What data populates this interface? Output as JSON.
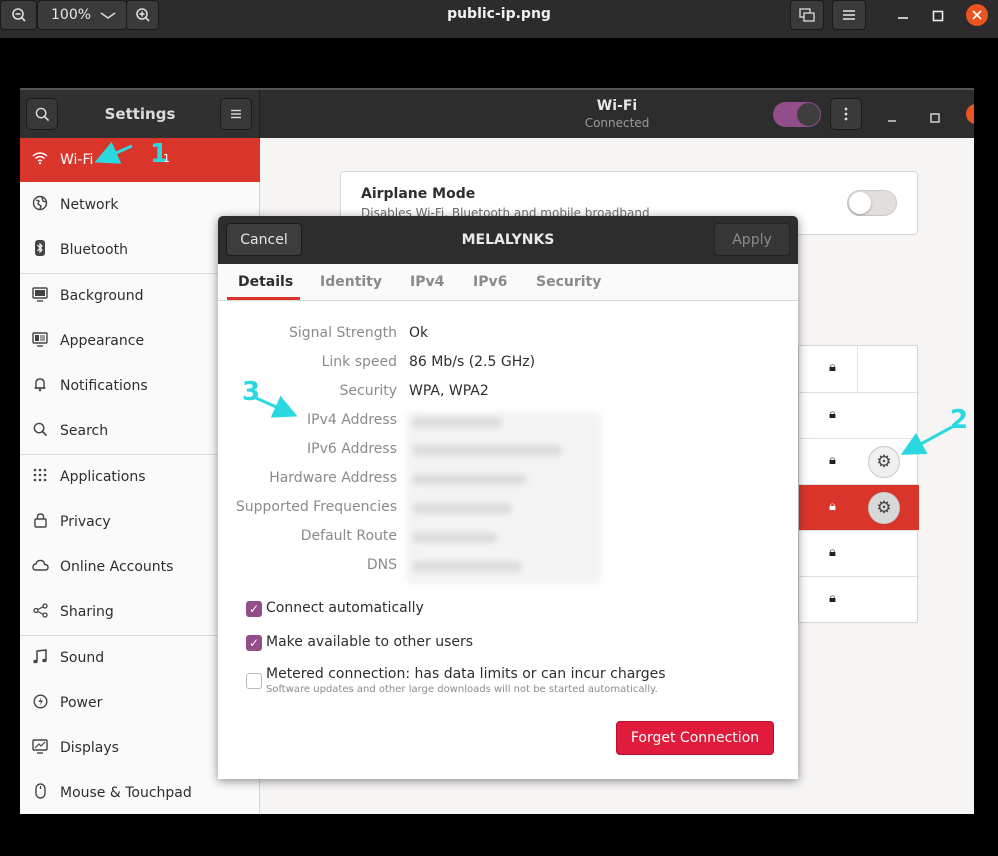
{
  "viewer": {
    "zoom": "100%",
    "title": "public-ip.png",
    "icons": [
      "zoom-out-icon",
      "chevron-down-icon",
      "zoom-in-icon",
      "fit-window-icon",
      "menu-icon",
      "minimize-icon",
      "maximize-icon",
      "close-icon"
    ]
  },
  "settings": {
    "title": "Settings",
    "header_title": "Wi-Fi",
    "header_subtitle": "Connected",
    "sidebar": [
      {
        "label": "Wi-Fi",
        "icon": "wifi-icon",
        "active": true
      },
      {
        "label": "Network",
        "icon": "globe-icon"
      },
      {
        "label": "Bluetooth",
        "icon": "bluetooth-icon"
      },
      {
        "label": "Background",
        "icon": "monitor-icon"
      },
      {
        "label": "Appearance",
        "icon": "appearance-icon"
      },
      {
        "label": "Notifications",
        "icon": "bell-icon"
      },
      {
        "label": "Search",
        "icon": "search-icon"
      },
      {
        "label": "Applications",
        "icon": "apps-grid-icon"
      },
      {
        "label": "Privacy",
        "icon": "lock-icon"
      },
      {
        "label": "Online Accounts",
        "icon": "cloud-icon"
      },
      {
        "label": "Sharing",
        "icon": "share-icon"
      },
      {
        "label": "Sound",
        "icon": "music-note-icon"
      },
      {
        "label": "Power",
        "icon": "power-icon"
      },
      {
        "label": "Displays",
        "icon": "display-icon"
      },
      {
        "label": "Mouse & Touchpad",
        "icon": "mouse-icon"
      }
    ],
    "airplane": {
      "title": "Airplane Mode",
      "subtitle": "Disables Wi-Fi, Bluetooth and mobile broadband"
    }
  },
  "dialog": {
    "cancel": "Cancel",
    "title": "MELALYNKS",
    "apply": "Apply",
    "tabs": [
      "Details",
      "Identity",
      "IPv4",
      "IPv6",
      "Security"
    ],
    "details": {
      "signal_strength_label": "Signal Strength",
      "signal_strength": "Ok",
      "link_speed_label": "Link speed",
      "link_speed": "86 Mb/s (2.5 GHz)",
      "security_label": "Security",
      "security": "WPA, WPA2",
      "ipv4_label": "IPv4 Address",
      "ipv6_label": "IPv6 Address",
      "hardware_label": "Hardware Address",
      "frequencies_label": "Supported Frequencies",
      "route_label": "Default Route",
      "dns_label": "DNS"
    },
    "connect_auto": "Connect automatically",
    "available_others": "Make available to other users",
    "metered": "Metered connection: has data limits or can incur charges",
    "metered_sub": "Software updates and other large downloads will not be started automatically.",
    "forget": "Forget Connection"
  },
  "annotations": {
    "one": "1",
    "two": "2",
    "three": "3"
  },
  "colors": {
    "accent_red": "#d9352a",
    "toggle_purple": "#924d8b",
    "forget_red": "#e01b3c",
    "annotation_cyan": "#2ad8e0"
  }
}
